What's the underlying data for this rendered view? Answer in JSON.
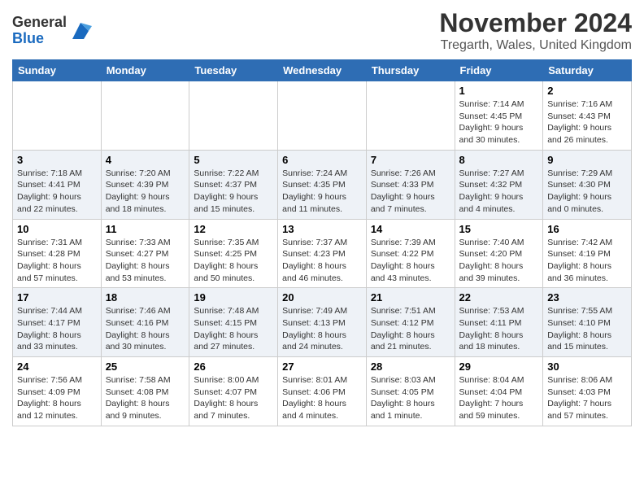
{
  "logo": {
    "general": "General",
    "blue": "Blue"
  },
  "header": {
    "month": "November 2024",
    "location": "Tregarth, Wales, United Kingdom"
  },
  "weekdays": [
    "Sunday",
    "Monday",
    "Tuesday",
    "Wednesday",
    "Thursday",
    "Friday",
    "Saturday"
  ],
  "weeks": [
    [
      {
        "day": "",
        "info": ""
      },
      {
        "day": "",
        "info": ""
      },
      {
        "day": "",
        "info": ""
      },
      {
        "day": "",
        "info": ""
      },
      {
        "day": "",
        "info": ""
      },
      {
        "day": "1",
        "info": "Sunrise: 7:14 AM\nSunset: 4:45 PM\nDaylight: 9 hours and 30 minutes."
      },
      {
        "day": "2",
        "info": "Sunrise: 7:16 AM\nSunset: 4:43 PM\nDaylight: 9 hours and 26 minutes."
      }
    ],
    [
      {
        "day": "3",
        "info": "Sunrise: 7:18 AM\nSunset: 4:41 PM\nDaylight: 9 hours and 22 minutes."
      },
      {
        "day": "4",
        "info": "Sunrise: 7:20 AM\nSunset: 4:39 PM\nDaylight: 9 hours and 18 minutes."
      },
      {
        "day": "5",
        "info": "Sunrise: 7:22 AM\nSunset: 4:37 PM\nDaylight: 9 hours and 15 minutes."
      },
      {
        "day": "6",
        "info": "Sunrise: 7:24 AM\nSunset: 4:35 PM\nDaylight: 9 hours and 11 minutes."
      },
      {
        "day": "7",
        "info": "Sunrise: 7:26 AM\nSunset: 4:33 PM\nDaylight: 9 hours and 7 minutes."
      },
      {
        "day": "8",
        "info": "Sunrise: 7:27 AM\nSunset: 4:32 PM\nDaylight: 9 hours and 4 minutes."
      },
      {
        "day": "9",
        "info": "Sunrise: 7:29 AM\nSunset: 4:30 PM\nDaylight: 9 hours and 0 minutes."
      }
    ],
    [
      {
        "day": "10",
        "info": "Sunrise: 7:31 AM\nSunset: 4:28 PM\nDaylight: 8 hours and 57 minutes."
      },
      {
        "day": "11",
        "info": "Sunrise: 7:33 AM\nSunset: 4:27 PM\nDaylight: 8 hours and 53 minutes."
      },
      {
        "day": "12",
        "info": "Sunrise: 7:35 AM\nSunset: 4:25 PM\nDaylight: 8 hours and 50 minutes."
      },
      {
        "day": "13",
        "info": "Sunrise: 7:37 AM\nSunset: 4:23 PM\nDaylight: 8 hours and 46 minutes."
      },
      {
        "day": "14",
        "info": "Sunrise: 7:39 AM\nSunset: 4:22 PM\nDaylight: 8 hours and 43 minutes."
      },
      {
        "day": "15",
        "info": "Sunrise: 7:40 AM\nSunset: 4:20 PM\nDaylight: 8 hours and 39 minutes."
      },
      {
        "day": "16",
        "info": "Sunrise: 7:42 AM\nSunset: 4:19 PM\nDaylight: 8 hours and 36 minutes."
      }
    ],
    [
      {
        "day": "17",
        "info": "Sunrise: 7:44 AM\nSunset: 4:17 PM\nDaylight: 8 hours and 33 minutes."
      },
      {
        "day": "18",
        "info": "Sunrise: 7:46 AM\nSunset: 4:16 PM\nDaylight: 8 hours and 30 minutes."
      },
      {
        "day": "19",
        "info": "Sunrise: 7:48 AM\nSunset: 4:15 PM\nDaylight: 8 hours and 27 minutes."
      },
      {
        "day": "20",
        "info": "Sunrise: 7:49 AM\nSunset: 4:13 PM\nDaylight: 8 hours and 24 minutes."
      },
      {
        "day": "21",
        "info": "Sunrise: 7:51 AM\nSunset: 4:12 PM\nDaylight: 8 hours and 21 minutes."
      },
      {
        "day": "22",
        "info": "Sunrise: 7:53 AM\nSunset: 4:11 PM\nDaylight: 8 hours and 18 minutes."
      },
      {
        "day": "23",
        "info": "Sunrise: 7:55 AM\nSunset: 4:10 PM\nDaylight: 8 hours and 15 minutes."
      }
    ],
    [
      {
        "day": "24",
        "info": "Sunrise: 7:56 AM\nSunset: 4:09 PM\nDaylight: 8 hours and 12 minutes."
      },
      {
        "day": "25",
        "info": "Sunrise: 7:58 AM\nSunset: 4:08 PM\nDaylight: 8 hours and 9 minutes."
      },
      {
        "day": "26",
        "info": "Sunrise: 8:00 AM\nSunset: 4:07 PM\nDaylight: 8 hours and 7 minutes."
      },
      {
        "day": "27",
        "info": "Sunrise: 8:01 AM\nSunset: 4:06 PM\nDaylight: 8 hours and 4 minutes."
      },
      {
        "day": "28",
        "info": "Sunrise: 8:03 AM\nSunset: 4:05 PM\nDaylight: 8 hours and 1 minute."
      },
      {
        "day": "29",
        "info": "Sunrise: 8:04 AM\nSunset: 4:04 PM\nDaylight: 7 hours and 59 minutes."
      },
      {
        "day": "30",
        "info": "Sunrise: 8:06 AM\nSunset: 4:03 PM\nDaylight: 7 hours and 57 minutes."
      }
    ]
  ]
}
